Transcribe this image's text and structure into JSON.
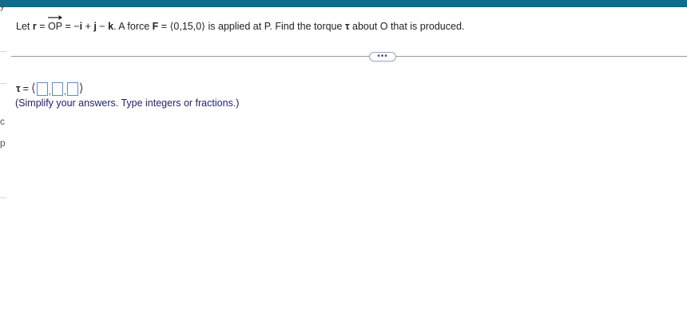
{
  "question": {
    "prefix": "Let ",
    "r": "r",
    "eq1": " = ",
    "op": "OP",
    "eq2": " = −",
    "i": "i",
    "plus": " + ",
    "j": "j",
    "minus": " − ",
    "k": "k",
    "mid": ". A force ",
    "F": "F",
    "force_value": " = ⟨0,15,0⟩  is applied at P. Find the torque ",
    "tau": "τ",
    "suffix": " about O that is produced."
  },
  "more_button": {
    "label": "•••"
  },
  "answer": {
    "tau": "τ",
    "equals": "=",
    "open": "⟨",
    "close": "⟩",
    "separator": ","
  },
  "hint": "(Simplify your answers. Type integers or fractions.)",
  "left_strip": {
    "chars": [
      "y",
      "c",
      "p"
    ]
  },
  "colors": {
    "top_bar": "#0f6d8c",
    "answer_box_border": "#5a8fc8",
    "hint_text": "#1f1f6e"
  }
}
